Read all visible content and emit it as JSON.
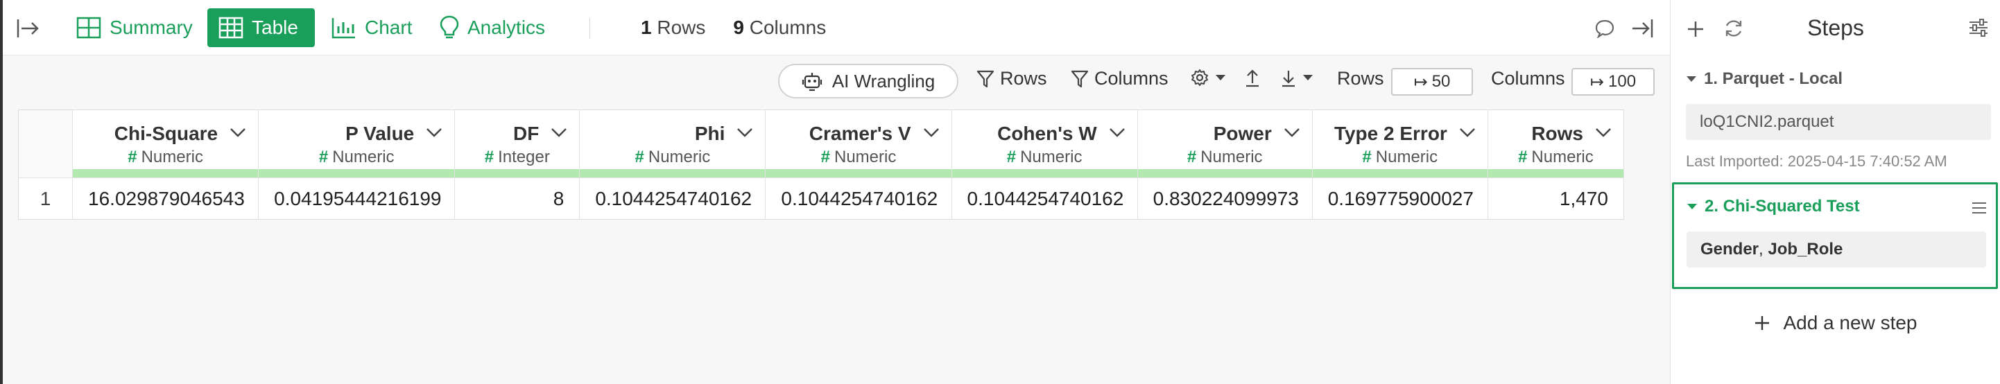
{
  "view_tabs": [
    {
      "label": "Summary",
      "icon": "summary-grid-icon"
    },
    {
      "label": "Table",
      "icon": "table-icon",
      "active": true
    },
    {
      "label": "Chart",
      "icon": "bar-chart-icon"
    },
    {
      "label": "Analytics",
      "icon": "lightbulb-icon"
    }
  ],
  "counts": {
    "rows_num": "1",
    "rows_label": "Rows",
    "cols_num": "9",
    "cols_label": "Columns"
  },
  "toolbar": {
    "ai_wrangling": "AI Wrangling",
    "rows_filter": "Rows",
    "columns_filter": "Columns",
    "rows_limit_label": "Rows",
    "rows_limit_value": "50",
    "columns_limit_label": "Columns",
    "columns_limit_value": "100"
  },
  "table": {
    "columns": [
      {
        "name": "Chi-Square",
        "type": "Numeric"
      },
      {
        "name": "P Value",
        "type": "Numeric"
      },
      {
        "name": "DF",
        "type": "Integer"
      },
      {
        "name": "Phi",
        "type": "Numeric"
      },
      {
        "name": "Cramer's V",
        "type": "Numeric"
      },
      {
        "name": "Cohen's W",
        "type": "Numeric"
      },
      {
        "name": "Power",
        "type": "Numeric"
      },
      {
        "name": "Type 2 Error",
        "type": "Numeric"
      },
      {
        "name": "Rows",
        "type": "Numeric"
      }
    ],
    "rows": [
      {
        "index": "1",
        "cells": [
          "16.029879046543",
          "0.04195444216199",
          "8",
          "0.1044254740162",
          "0.1044254740162",
          "0.1044254740162",
          "0.830224099973",
          "0.169775900027",
          "1,470"
        ]
      }
    ]
  },
  "steps": {
    "title": "Steps",
    "step1": {
      "title": "1. Parquet - Local",
      "file": "loQ1CNI2.parquet",
      "meta": "Last Imported: 2025-04-15 7:40:52 AM"
    },
    "step2": {
      "title": "2. Chi-Squared Test",
      "param1": "Gender",
      "separator": ", ",
      "param2": "Job_Role"
    },
    "add_step": "Add a new step"
  },
  "colors": {
    "accent": "#1a9f5a",
    "column_bar": "#b3e8b0"
  }
}
